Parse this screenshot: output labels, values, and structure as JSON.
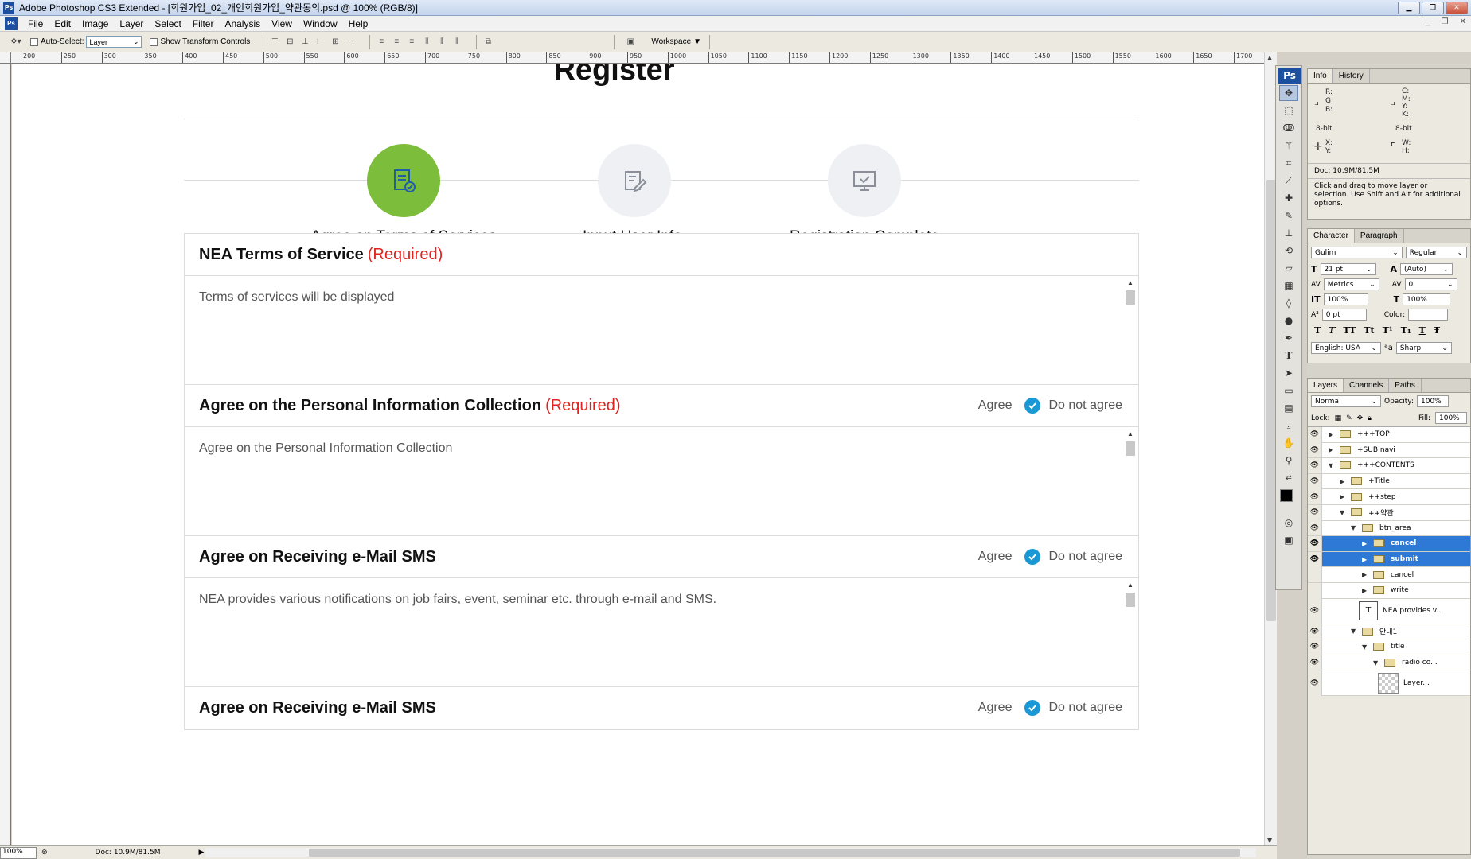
{
  "window": {
    "title": "Adobe Photoshop CS3 Extended - [회원가입_02_개인회원가입_약관동의.psd @ 100% (RGB/8)]"
  },
  "menu": [
    "File",
    "Edit",
    "Image",
    "Layer",
    "Select",
    "Filter",
    "Analysis",
    "View",
    "Window",
    "Help"
  ],
  "options": {
    "auto_select_label": "Auto-Select:",
    "auto_select_value": "Layer",
    "transform_label": "Show Transform Controls",
    "workspace_label": "Workspace"
  },
  "ruler_labels": [
    "200",
    "250",
    "300",
    "350",
    "400",
    "450",
    "500",
    "550",
    "600",
    "650",
    "700",
    "750",
    "800",
    "850",
    "900",
    "950",
    "1000",
    "1050",
    "1100",
    "1150",
    "1200",
    "1250",
    "1300",
    "1350",
    "1400",
    "1450",
    "1500",
    "1550",
    "1600",
    "1650",
    "1700"
  ],
  "page": {
    "title": "Register",
    "steps": [
      {
        "label": "Agree on  Terms of Services",
        "active": true,
        "icon": "document-check-icon"
      },
      {
        "label": "Input User Info.",
        "active": false,
        "icon": "document-edit-icon"
      },
      {
        "label": "Registration Complete",
        "active": false,
        "icon": "monitor-check-icon"
      }
    ],
    "sections": [
      {
        "title": "NEA Terms of Service",
        "required": "(Required)",
        "body": "Terms of services will be displayed",
        "agree": "",
        "disagree": ""
      },
      {
        "title": "Agree on the Personal Information Collection",
        "required": "(Required)",
        "body": "Agree on the Personal Information Collection",
        "agree": "Agree",
        "disagree": "Do not agree"
      },
      {
        "title": "Agree on Receiving e-Mail SMS",
        "required": "",
        "body": "NEA provides various notifications on job fairs, event, seminar etc. through e-mail and SMS.",
        "agree": "Agree",
        "disagree": "Do not agree"
      },
      {
        "title": "Agree on Receiving e-Mail SMS",
        "required": "",
        "body": "",
        "agree": "Agree",
        "disagree": "Do not agree"
      }
    ]
  },
  "status": {
    "zoom": "100%",
    "doc": "Doc: 10.9M/81.5M"
  },
  "info_panel": {
    "tabs": [
      "Info",
      "History"
    ],
    "rgb": [
      "R:",
      "G:",
      "B:"
    ],
    "cmyk": [
      "C:",
      "M:",
      "Y:",
      "K:"
    ],
    "bit_left": "8-bit",
    "bit_right": "8-bit",
    "xy": [
      "X:",
      "Y:"
    ],
    "wh": [
      "W:",
      "H:"
    ],
    "doc": "Doc: 10.9M/81.5M",
    "hint": "Click and drag to move layer or selection.  Use Shift and Alt for additional options."
  },
  "character_panel": {
    "tabs": [
      "Character",
      "Paragraph"
    ],
    "font": "Gulim",
    "style": "Regular",
    "size": "21 pt",
    "leading": "(Auto)",
    "kerning": "Metrics",
    "tracking": "0",
    "vscale": "100%",
    "hscale": "100%",
    "baseline": "0 pt",
    "color_label": "Color:",
    "lang": "English: USA",
    "aa": "Sharp",
    "aa_prefix": "ªa",
    "type_buttons": [
      "T",
      "T",
      "TT",
      "Tt",
      "T¹",
      "T₁",
      "T",
      "Ŧ"
    ]
  },
  "layers_panel": {
    "tabs": [
      "Layers",
      "Channels",
      "Paths"
    ],
    "blend": "Normal",
    "opacity_label": "Opacity:",
    "opacity": "100%",
    "lock_label": "Lock:",
    "fill_label": "Fill:",
    "fill": "100%",
    "rows": [
      {
        "name": "+++TOP",
        "indent": 0,
        "open": false,
        "sel": false,
        "eye": true
      },
      {
        "name": "+SUB navi",
        "indent": 0,
        "open": false,
        "sel": false,
        "eye": true
      },
      {
        "name": "+++CONTENTS",
        "indent": 0,
        "open": true,
        "sel": false,
        "eye": true
      },
      {
        "name": "+Title",
        "indent": 1,
        "open": false,
        "sel": false,
        "eye": true
      },
      {
        "name": "++step",
        "indent": 1,
        "open": false,
        "sel": false,
        "eye": true
      },
      {
        "name": "++약관",
        "indent": 1,
        "open": true,
        "sel": false,
        "eye": true
      },
      {
        "name": "btn_area",
        "indent": 2,
        "open": true,
        "sel": false,
        "eye": true
      },
      {
        "name": "cancel",
        "indent": 3,
        "open": false,
        "sel": true,
        "eye": true
      },
      {
        "name": "submit",
        "indent": 3,
        "open": false,
        "sel": true,
        "eye": true
      },
      {
        "name": "cancel",
        "indent": 3,
        "open": false,
        "sel": false,
        "eye": false
      },
      {
        "name": "write",
        "indent": 3,
        "open": false,
        "sel": false,
        "eye": false
      }
    ],
    "text_layer": "NEA provides v...",
    "rows2": [
      {
        "name": "안내1",
        "indent": 2,
        "open": true
      },
      {
        "name": "title",
        "indent": 3,
        "open": true
      },
      {
        "name": "radio co...",
        "indent": 4,
        "open": true
      }
    ],
    "thumb_layer": "Layer..."
  }
}
